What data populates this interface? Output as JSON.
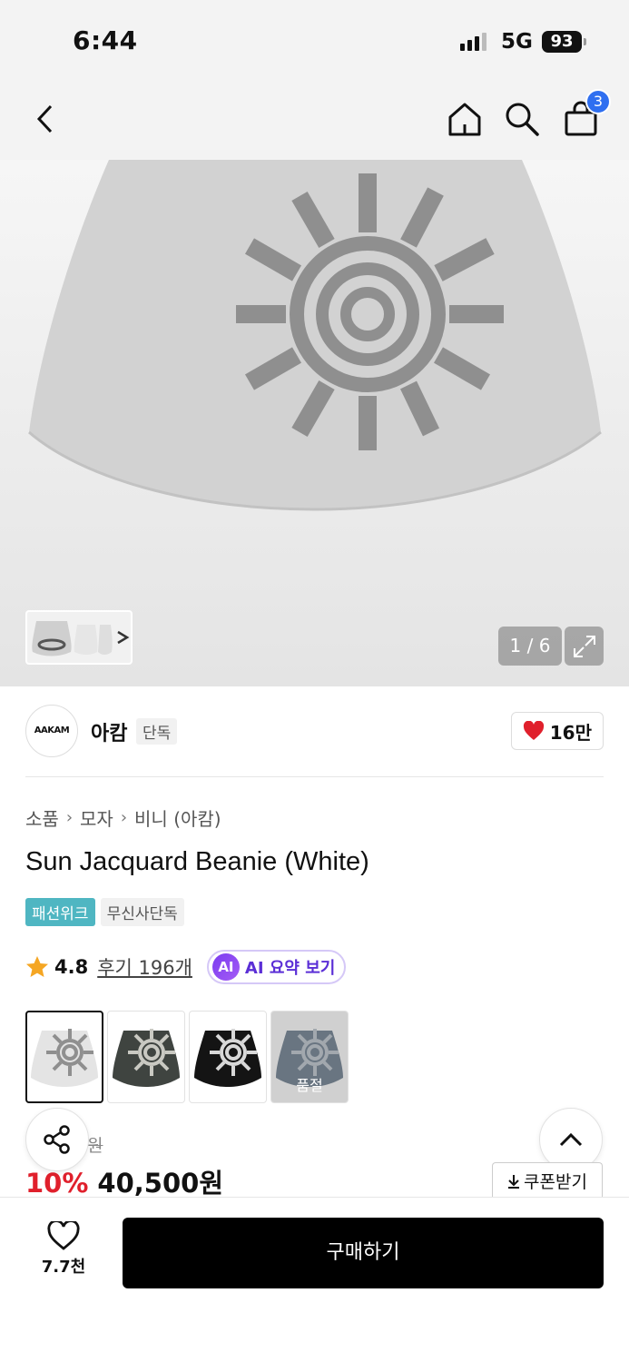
{
  "status": {
    "time": "6:44",
    "network": "5G",
    "battery": "93"
  },
  "nav": {
    "cart_count": "3"
  },
  "gallery": {
    "counter": "1 / 6"
  },
  "brand": {
    "logo_text": "AAKAM",
    "name": "아캄",
    "tag": "단독",
    "likes": "16만"
  },
  "breadcrumb": [
    "소품",
    "모자",
    "비니 (아캄)"
  ],
  "product": {
    "title": "Sun Jacquard Beanie (White)",
    "tags": [
      "패션위크",
      "무신사단독"
    ],
    "rating": "4.8",
    "reviews": "후기 196개",
    "ai_label": "AI 요약 보기",
    "ai_badge": "AI",
    "soldout_label": "품절",
    "original_price": "원",
    "discount": "10%",
    "price": "40,500원",
    "colors": [
      {
        "name": "white",
        "fill": "#e4e4e4",
        "pattern": "#8f8f8f",
        "selected": true
      },
      {
        "name": "charcoal",
        "fill": "#3f4440",
        "pattern": "#c9c9c2"
      },
      {
        "name": "black",
        "fill": "#141414",
        "pattern": "#d8d8d8"
      },
      {
        "name": "navy",
        "fill": "#1c3550",
        "pattern": "#9aa7b4",
        "soldout": true
      }
    ]
  },
  "actions": {
    "coupon": "쿠폰받기",
    "wish_count": "7.7천",
    "buy": "구매하기"
  },
  "colors": {
    "accent": "#2f6ff0",
    "discount": "#e0202c",
    "tag_week": "#4fb6c2",
    "ai": "#5b2fd6"
  }
}
